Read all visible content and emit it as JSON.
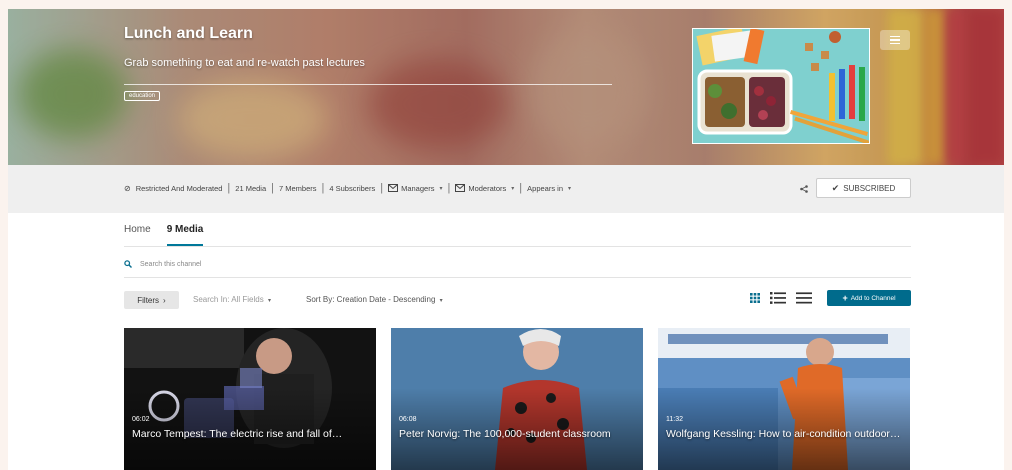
{
  "channel": {
    "title": "Lunch and Learn",
    "description": "Grab something to eat and re-watch past lectures",
    "tag": "education"
  },
  "info_bar": {
    "restriction": "Restricted And Moderated",
    "media_count": "21 Media",
    "members_count": "7 Members",
    "subscribers_count": "4 Subscribers",
    "managers_label": "Managers",
    "moderators_label": "Moderators",
    "appears_in_label": "Appears in",
    "subscribed_label": "SUBSCRIBED"
  },
  "tabs": [
    {
      "label": "Home"
    },
    {
      "label": "9 Media"
    }
  ],
  "search": {
    "placeholder": "Search this channel"
  },
  "toolbar": {
    "filters_label": "Filters",
    "search_in": "Search In: All Fields",
    "sort_by": "Sort By: Creation Date - Descending",
    "add_label": "Add to Channel"
  },
  "media": [
    {
      "duration": "06:02",
      "title": "Marco Tempest: The electric rise and fall of…"
    },
    {
      "duration": "06:08",
      "title": "Peter Norvig: The 100,000-student classroom"
    },
    {
      "duration": "11:32",
      "title": "Wolfgang Kessling: How to air-condition outdoor…"
    }
  ],
  "colors": {
    "accent": "#006b8c",
    "tab_underline": "#00789a",
    "info_bar": "#efefef",
    "page_bg": "#fbf3ee"
  },
  "icons": {
    "restriction": "restricted-icon",
    "managers": "envelope-icon",
    "moderators": "envelope-icon",
    "share": "share-icon",
    "subscribed": "checkmark-icon",
    "search": "search-icon",
    "views": [
      "grid-view-icon",
      "detailed-list-icon",
      "compact-list-icon"
    ],
    "add": "plus-icon",
    "menu": "menu-icon"
  }
}
